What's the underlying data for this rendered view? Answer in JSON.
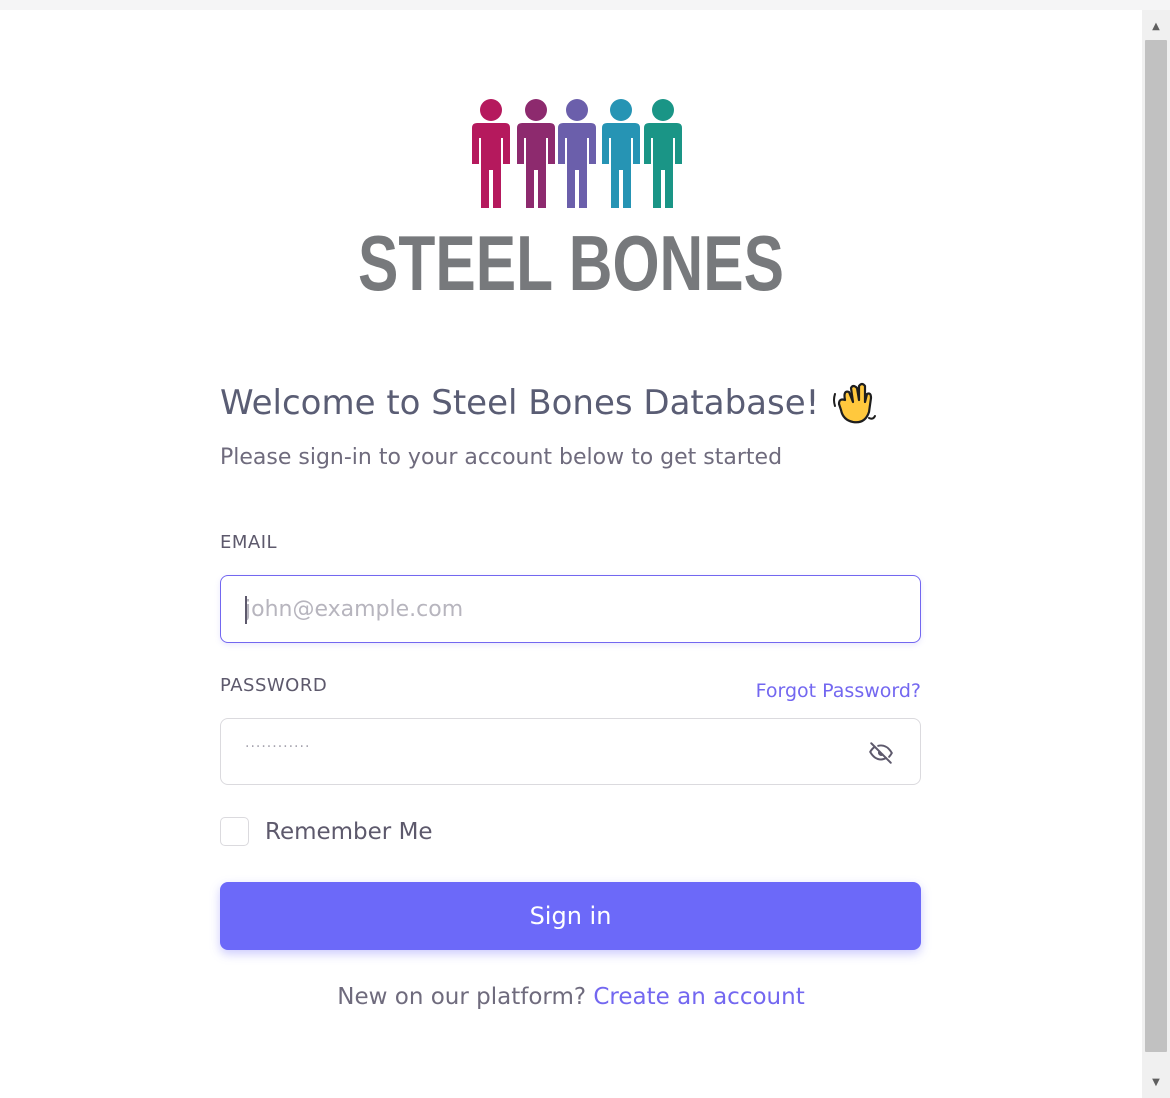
{
  "brand": {
    "logo_text": "STEEL BONES",
    "figure_colors": [
      "#b5195d",
      "#8d2a6e",
      "#6b5fab",
      "#2694b4",
      "#1a9586"
    ],
    "text_color": "#77797c"
  },
  "header": {
    "welcome": "Welcome to Steel Bones Database!",
    "wave_icon": "waving-hand-icon",
    "subtitle": "Please sign-in to your account below to get started"
  },
  "form": {
    "email_label": "EMAIL",
    "email_placeholder": "john@example.com",
    "email_value": "",
    "password_label": "PASSWORD",
    "forgot_password": "Forgot Password?",
    "password_mask": "············",
    "eye_icon": "eye-off-icon",
    "remember_me": "Remember Me",
    "remember_checked": false,
    "signin_button": "Sign in"
  },
  "footer": {
    "prompt": "New on our platform?",
    "create_account": "Create an account"
  },
  "colors": {
    "primary": "#7367f0",
    "button": "#6c69f9",
    "heading": "#5a5d74",
    "border": "#dbdade"
  }
}
